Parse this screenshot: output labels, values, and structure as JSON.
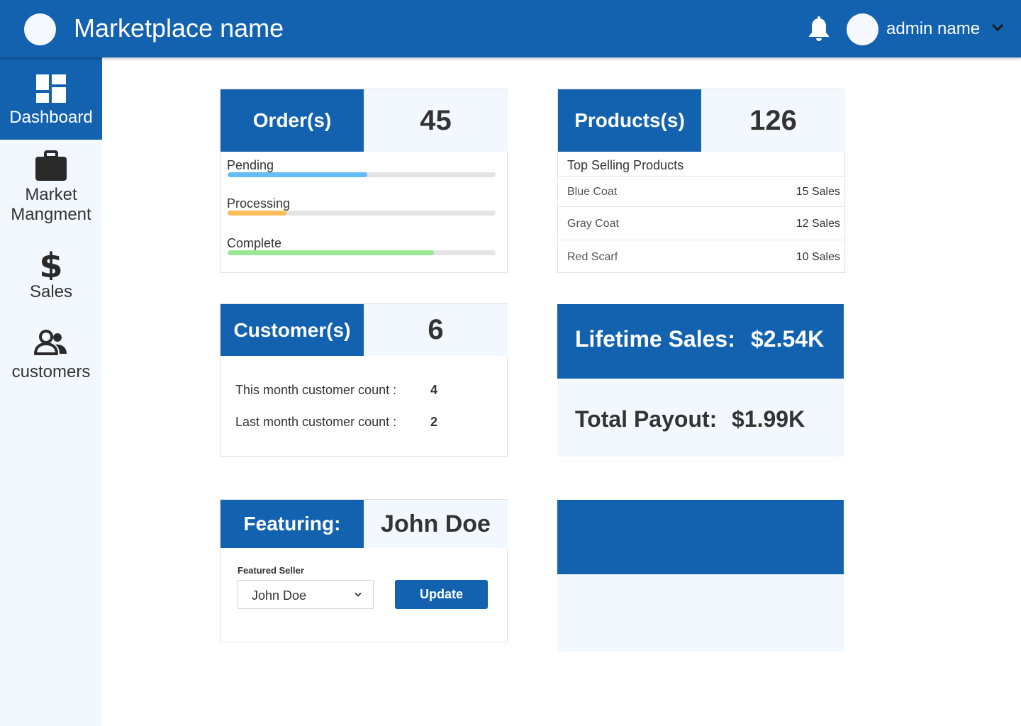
{
  "header": {
    "title": "Marketplace name",
    "admin_name": "admin name"
  },
  "sidebar": {
    "items": [
      {
        "label": "Dashboard",
        "icon": "dashboard-icon",
        "active": true
      },
      {
        "label": "Market\nMangment",
        "icon": "briefcase-icon",
        "active": false
      },
      {
        "label": "Sales",
        "icon": "dollar-icon",
        "active": false
      },
      {
        "label": "customers",
        "icon": "people-icon",
        "active": false
      }
    ]
  },
  "orders": {
    "label": "Order(s)",
    "count": "45",
    "statuses": [
      {
        "label": "Pending",
        "progress": 0.52,
        "color": "#64bdf4"
      },
      {
        "label": "Processing",
        "progress": 0.22,
        "color": "#fcbc5a"
      },
      {
        "label": "Complete",
        "progress": 0.77,
        "color": "#9be694"
      }
    ]
  },
  "products": {
    "label": "Products(s)",
    "count": "126",
    "top_selling_title": "Top Selling Products",
    "rows": [
      {
        "name": "Blue Coat",
        "sales": "15 Sales"
      },
      {
        "name": "Gray Coat",
        "sales": "12 Sales"
      },
      {
        "name": "Red Scarf",
        "sales": "10 Sales"
      }
    ]
  },
  "customers": {
    "label": "Customer(s)",
    "count": "6",
    "this_month_label": "This month customer count :",
    "this_month_value": "4",
    "last_month_label": "Last month customer count :",
    "last_month_value": "2"
  },
  "lifetime": {
    "sales_label": "Lifetime Sales:",
    "sales_value": "$2.54K",
    "payout_label": "Total Payout:",
    "payout_value": "$1.99K"
  },
  "featuring": {
    "label": "Featuring:",
    "value": "John Doe",
    "field_label": "Featured Seller",
    "selected_seller": "John Doe",
    "update_label": "Update"
  },
  "colors": {
    "primary": "#1262b0",
    "light_panel": "#f2f8fe"
  }
}
